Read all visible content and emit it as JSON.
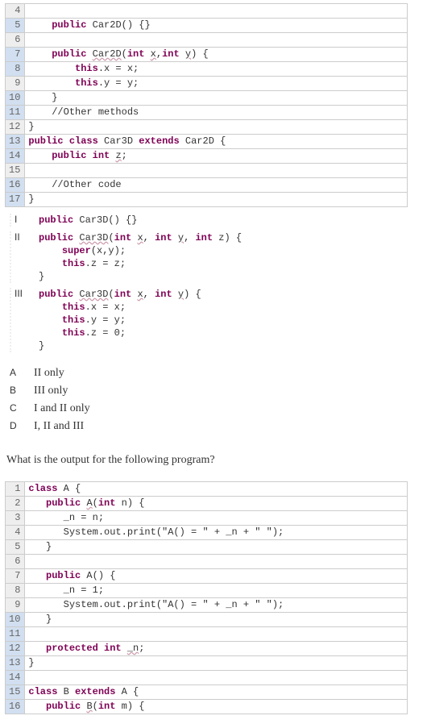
{
  "code1": {
    "lines": [
      {
        "n": "4",
        "hl": false,
        "html": ""
      },
      {
        "n": "5",
        "hl": true,
        "html": "    <span class='kw'>public</span> Car2D() {}"
      },
      {
        "n": "6",
        "hl": false,
        "html": ""
      },
      {
        "n": "7",
        "hl": true,
        "html": "    <span class='kw'>public</span> <span class='und'>Car2D</span>(<span class='kw'>int</span> <span class='und2'>x</span>,<span class='kw'>int</span> <span class='und2'>y</span>) {"
      },
      {
        "n": "8",
        "hl": true,
        "html": "        <span class='kw'>this</span>.x = x;"
      },
      {
        "n": "9",
        "hl": false,
        "html": "        <span class='kw'>this</span>.y = y;"
      },
      {
        "n": "10",
        "hl": true,
        "html": "    }"
      },
      {
        "n": "11",
        "hl": true,
        "html": "    //Other methods"
      },
      {
        "n": "12",
        "hl": false,
        "html": "}"
      },
      {
        "n": "13",
        "hl": true,
        "html": "<span class='kw'>public</span> <span class='kw'>class</span> Car3D <span class='kw'>extends</span> Car2D {"
      },
      {
        "n": "14",
        "hl": true,
        "html": "    <span class='kw'>public</span> <span class='kw'>int</span> <span class='und'>z</span>;"
      },
      {
        "n": "15",
        "hl": false,
        "html": ""
      },
      {
        "n": "16",
        "hl": true,
        "html": "    //Other code"
      },
      {
        "n": "17",
        "hl": true,
        "html": "}"
      }
    ]
  },
  "options": [
    {
      "label": "I",
      "code": "<span class='kw'>public</span> Car3D() {}"
    },
    {
      "label": "II",
      "code": "<span class='kw'>public</span> <span class='und'>Car3D</span>(<span class='kw'>int</span> <span class='und2'>x</span>, <span class='kw'>int</span> <span class='und2'>y</span>, <span class='kw'>int</span> z) {\n    <span class='kw'>super</span>(x,y);\n    <span class='kw'>this</span>.z = z;\n}"
    },
    {
      "label": "III",
      "code": "<span class='kw'>public</span> <span class='und'>Car3D</span>(<span class='kw'>int</span> <span class='und2'>x</span>, <span class='kw'>int</span> <span class='und2'>y</span>) {\n    <span class='kw'>this</span>.x = x;\n    <span class='kw'>this</span>.y = y;\n    <span class='kw'>this</span>.z = 0;\n}"
    }
  ],
  "answers": [
    {
      "letter": "A",
      "text": "II only"
    },
    {
      "letter": "B",
      "text": "III only"
    },
    {
      "letter": "C",
      "text": "I and II only"
    },
    {
      "letter": "D",
      "text": "I, II and III"
    }
  ],
  "question2": "What is the output for the following program?",
  "code2": {
    "lines": [
      {
        "n": "1",
        "hl": false,
        "html": "<span class='kw'>class</span> A {"
      },
      {
        "n": "2",
        "hl": false,
        "html": "   <span class='kw'>public</span> <span class='und'>A</span>(<span class='kw'>int</span> n) {"
      },
      {
        "n": "3",
        "hl": false,
        "html": "      _n = n;"
      },
      {
        "n": "4",
        "hl": false,
        "html": "      System.out.print(\"A() = \" + _n + \" \");"
      },
      {
        "n": "5",
        "hl": false,
        "html": "   }"
      },
      {
        "n": "6",
        "hl": false,
        "html": ""
      },
      {
        "n": "7",
        "hl": false,
        "html": "   <span class='kw'>public</span> A() {"
      },
      {
        "n": "8",
        "hl": false,
        "html": "      _n = 1;"
      },
      {
        "n": "9",
        "hl": false,
        "html": "      System.out.print(\"A() = \" + _n + \" \");"
      },
      {
        "n": "10",
        "hl": true,
        "html": "   }"
      },
      {
        "n": "11",
        "hl": true,
        "html": ""
      },
      {
        "n": "12",
        "hl": true,
        "html": "   <span class='kw'>protected</span> <span class='kw'>int</span> <span class='und'>_n</span>;"
      },
      {
        "n": "13",
        "hl": true,
        "html": "}"
      },
      {
        "n": "14",
        "hl": true,
        "html": ""
      },
      {
        "n": "15",
        "hl": true,
        "html": "<span class='kw'>class</span> B <span class='kw'>extends</span> A {"
      },
      {
        "n": "16",
        "hl": true,
        "html": "   <span class='kw'>public</span> <span class='und'>B</span>(<span class='kw'>int</span> m) {"
      }
    ]
  }
}
